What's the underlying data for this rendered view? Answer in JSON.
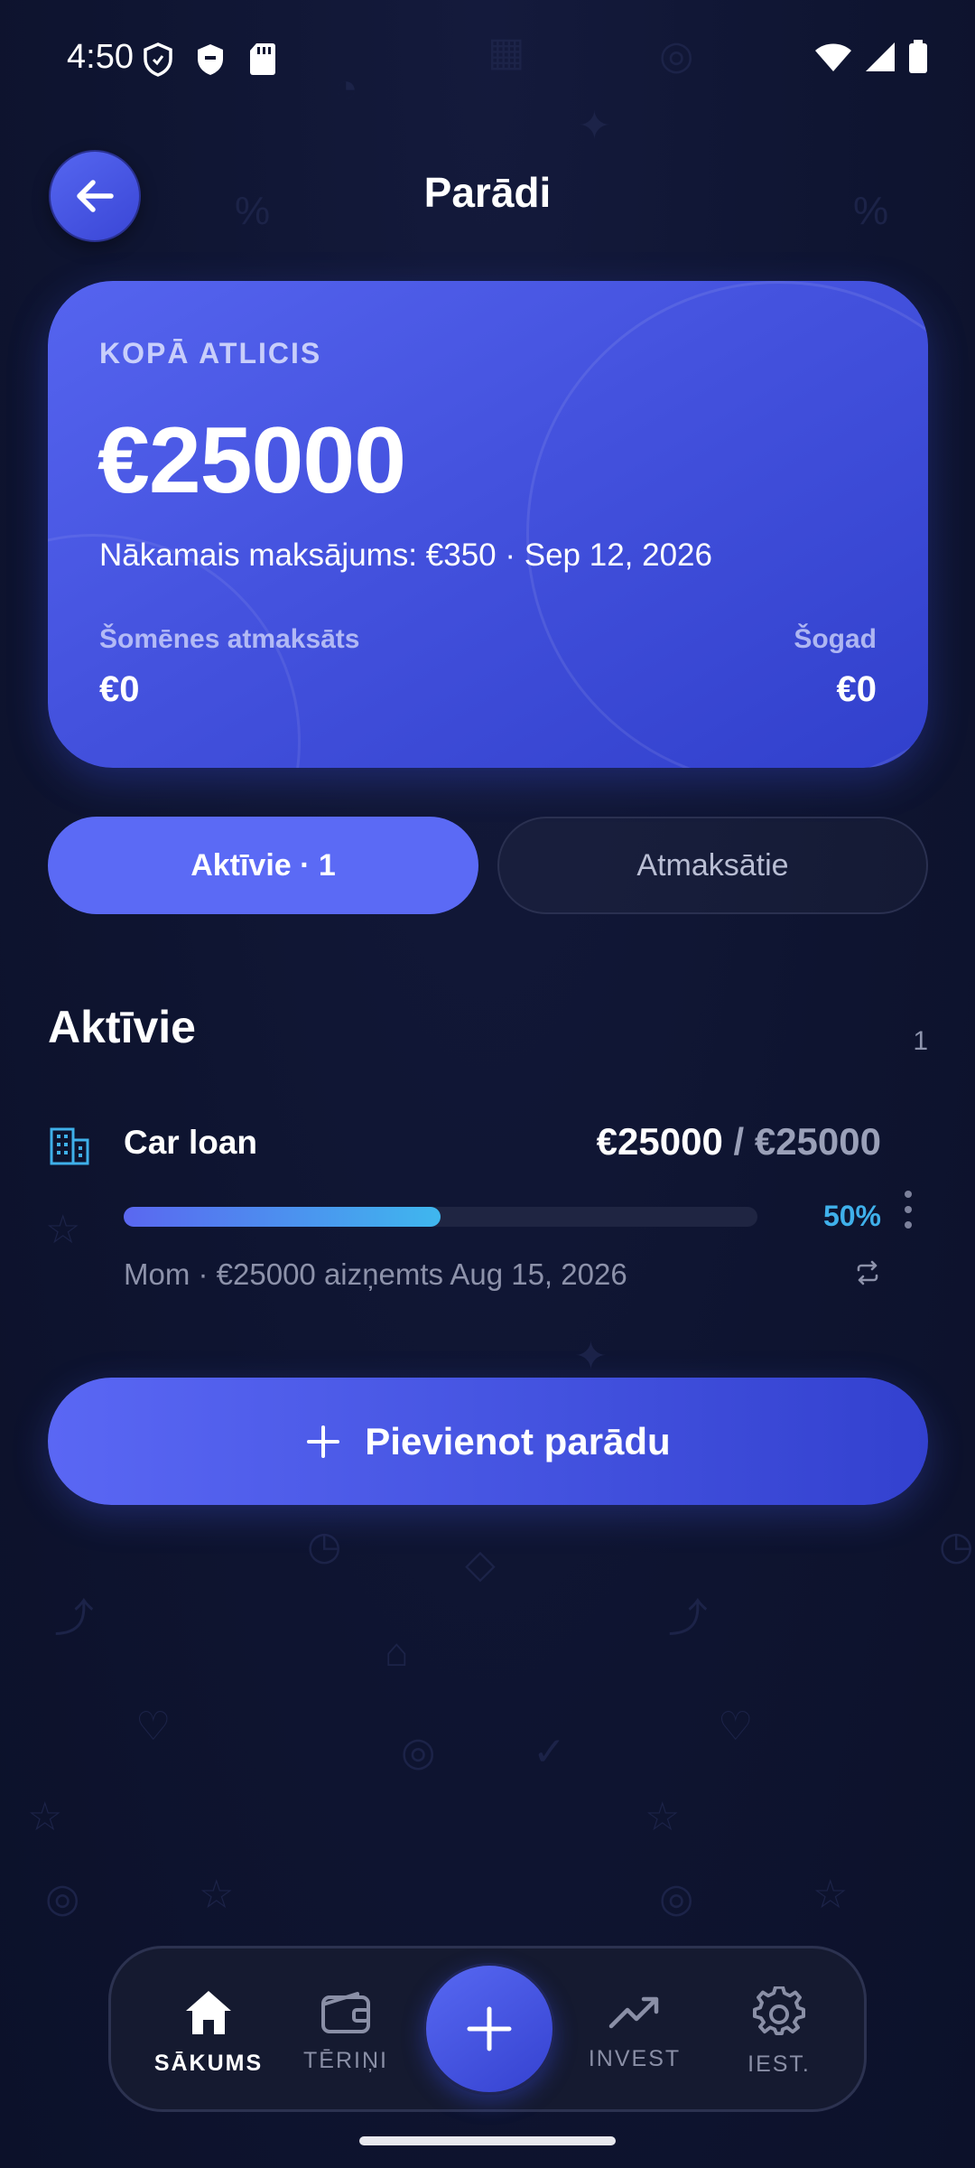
{
  "status_bar": {
    "time": "4:50"
  },
  "header": {
    "title": "Parādi"
  },
  "summary": {
    "label": "KOPĀ ATLICIS",
    "amount": "€25000",
    "next_payment": "Nākamais maksājums: €350 · Sep 12, 2026",
    "month_label": "Šomēnes atmaksāts",
    "month_value": "€0",
    "year_label": "Šogad",
    "year_value": "€0"
  },
  "tabs": {
    "active": "Aktīvie · 1",
    "paid": "Atmaksātie"
  },
  "section": {
    "title": "Aktīvie",
    "count": "1"
  },
  "debts": [
    {
      "name": "Car loan",
      "remaining": "€25000",
      "separator": "/",
      "total": "€25000",
      "progress_fraction": 0.5,
      "percent": "50%",
      "meta": "Mom · €25000 aizņemts Aug 15, 2026",
      "icon": "building-icon"
    }
  ],
  "add_button": {
    "label": "Pievienot parādu"
  },
  "nav": {
    "home": "SĀKUMS",
    "expenses": "TĒRIŅI",
    "invest": "INVEST",
    "settings": "IEST."
  },
  "colors": {
    "background": "#0e1430",
    "accent": "#5b6af5",
    "progress_end": "#3fb7ee",
    "percent": "#3fb0ea"
  }
}
